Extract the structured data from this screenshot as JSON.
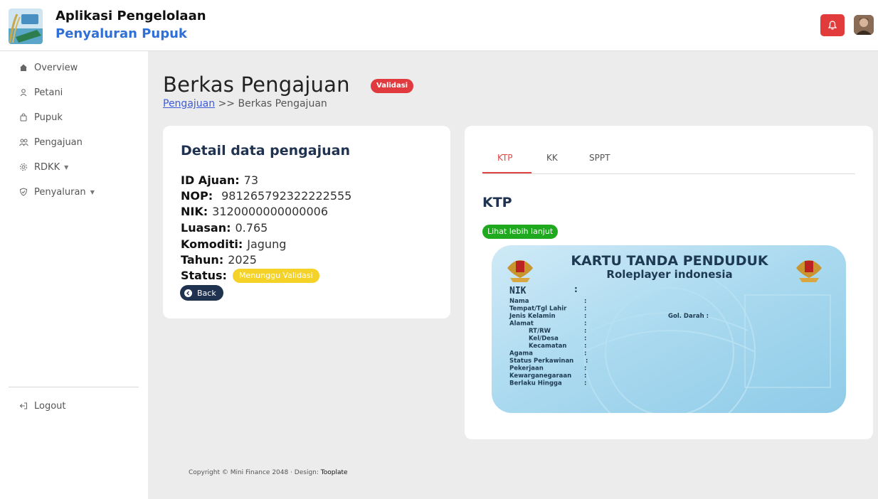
{
  "header": {
    "title_line1": "Aplikasi Pengelolaan",
    "title_line2": "Penyaluran Pupuk",
    "icons": [
      "app-logo",
      "bell-icon",
      "user-avatar"
    ]
  },
  "sidebar": {
    "items": [
      {
        "label": "Overview",
        "icon": "home-icon"
      },
      {
        "label": "Petani",
        "icon": "user-icon"
      },
      {
        "label": "Pupuk",
        "icon": "bag-icon"
      },
      {
        "label": "Pengajuan",
        "icon": "people-icon"
      },
      {
        "label": "RDKK",
        "icon": "gear-icon",
        "dropdown": true
      },
      {
        "label": "Penyaluran",
        "icon": "shield-icon",
        "dropdown": true
      }
    ],
    "logout_label": "Logout"
  },
  "page": {
    "title": "Berkas Pengajuan",
    "badge": "Validasi",
    "breadcrumb_link": "Pengajuan",
    "breadcrumb_sep": ">>",
    "breadcrumb_current": "Berkas Pengajuan"
  },
  "detail": {
    "title": "Detail data pengajuan",
    "fields": [
      {
        "label": "ID Ajuan:",
        "value": "73"
      },
      {
        "label": "NOP:",
        "value": "981265792322222555"
      },
      {
        "label": "NIK:",
        "value": "3120000000000006"
      },
      {
        "label": "Luasan:",
        "value": "0.765"
      },
      {
        "label": "Komoditi:",
        "value": "Jagung"
      },
      {
        "label": "Tahun:",
        "value": "2025"
      }
    ],
    "status_label": "Status:",
    "status_value": "Menunggu Validasi",
    "back_label": "Back"
  },
  "documents": {
    "tabs": [
      "KTP",
      "KK",
      "SPPT"
    ],
    "active_tab": "KTP",
    "heading": "KTP",
    "more_label": "Lihat lebih lanjut",
    "ktp_card": {
      "title": "KARTU TANDA PENDUDUK",
      "subtitle": "Roleplayer indonesia",
      "nik_label": "NIK",
      "fields": [
        "Nama",
        "Tempat/Tgl Lahir",
        "Jenis Kelamin",
        "Alamat",
        "RT/RW",
        "Kel/Desa",
        "Kecamatan",
        "Agama",
        "Status Perkawinan",
        "Pekerjaan",
        "Kewarganegaraan",
        "Berlaku Hingga"
      ],
      "gol_darah_label": "Gol. Darah :"
    }
  },
  "footer": {
    "text": "Copyright © Mini Finance 2048 · Design: ",
    "brand": "Tooplate"
  },
  "colors": {
    "accent_red": "#e03a3e",
    "primary_blue": "#2f6fd6",
    "navy": "#1f3250",
    "success_green": "#1ea91e",
    "warning_yellow": "#f4d227"
  }
}
